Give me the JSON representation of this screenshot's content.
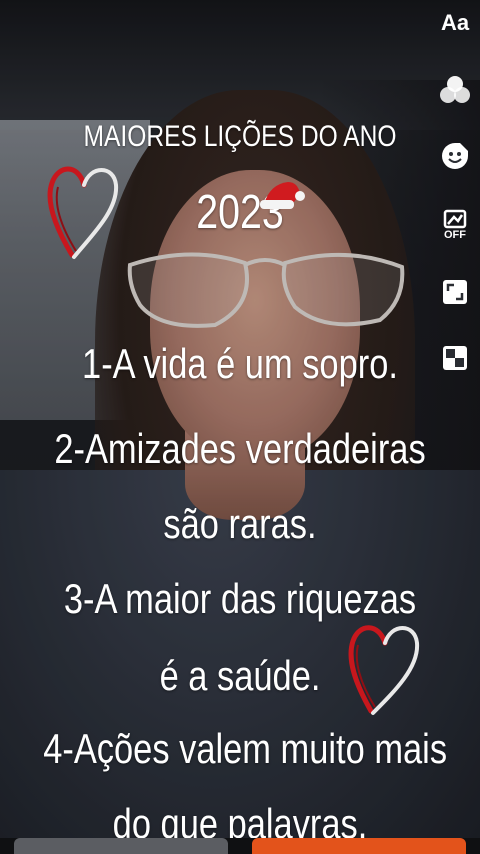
{
  "story": {
    "title": "MAIORES LIÇÕES DO ANO",
    "year": "2023",
    "lines": [
      "1-A vida é um sopro.",
      "2-Amizades verdadeiras",
      "são raras.",
      "3-A maior das riquezas",
      "é a saúde.",
      "4-Ações valem muito mais",
      "do que palavras."
    ]
  },
  "toolbar": {
    "text_label": "Aa",
    "filter_icon": "circles-icon",
    "sticker_icon": "emoji-icon",
    "effect_off_label": "OFF",
    "crop_icon": "crop-icon",
    "pattern_icon": "checker-icon"
  },
  "stickers": {
    "heart_icon": "heart-icon",
    "santa_hat_icon": "santa-hat-icon"
  },
  "colors": {
    "accent": "#e3531b",
    "heart_red": "#c8171d",
    "text": "#ffffff"
  }
}
